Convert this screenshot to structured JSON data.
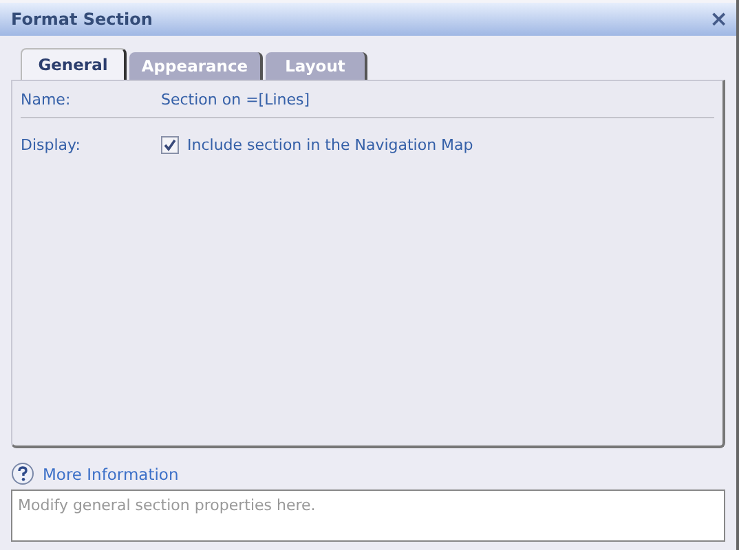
{
  "window": {
    "title": "Format Section",
    "close": "×"
  },
  "tabs": [
    {
      "label": "General",
      "selected": true
    },
    {
      "label": "Appearance",
      "selected": false
    },
    {
      "label": "Layout",
      "selected": false
    }
  ],
  "fields": [
    {
      "kind": "text",
      "label": "Name:",
      "value": "Section on =[Lines]"
    },
    {
      "kind": "checkbox",
      "label": "Display:",
      "value": "Include section in the Navigation Map",
      "checked": true
    }
  ],
  "info": {
    "link": "More Information",
    "description": "Modify general section properties here."
  }
}
